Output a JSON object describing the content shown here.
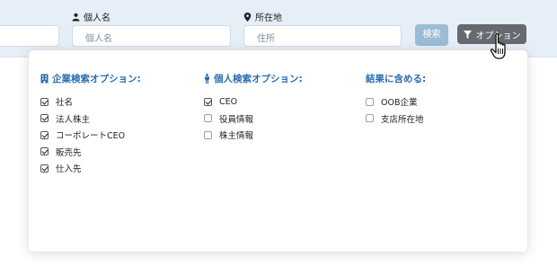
{
  "search": {
    "person_label": "個人名",
    "person_placeholder": "個人名",
    "address_label": "所在地",
    "address_placeholder": "住所",
    "search_button": "検索",
    "options_button": "オプション"
  },
  "options_panel": {
    "company": {
      "title": "企業検索オプション:",
      "items": [
        {
          "label": "社名",
          "checked": true
        },
        {
          "label": "法人株主",
          "checked": true
        },
        {
          "label": "コーポレートCEO",
          "checked": true
        },
        {
          "label": "販売先",
          "checked": true
        },
        {
          "label": "仕入先",
          "checked": true
        }
      ]
    },
    "person": {
      "title": "個人検索オプション:",
      "items": [
        {
          "label": "CEO",
          "checked": true
        },
        {
          "label": "役員情報",
          "checked": false
        },
        {
          "label": "株主情報",
          "checked": false
        }
      ]
    },
    "results": {
      "title": "結果に含める:",
      "items": [
        {
          "label": "OOB企業",
          "checked": false
        },
        {
          "label": "支店所在地",
          "checked": false
        }
      ]
    }
  },
  "colors": {
    "accent": "#2a6db0",
    "search_button": "#9bbcd6",
    "options_button": "#666a70",
    "topbar": "#e6eff7"
  }
}
